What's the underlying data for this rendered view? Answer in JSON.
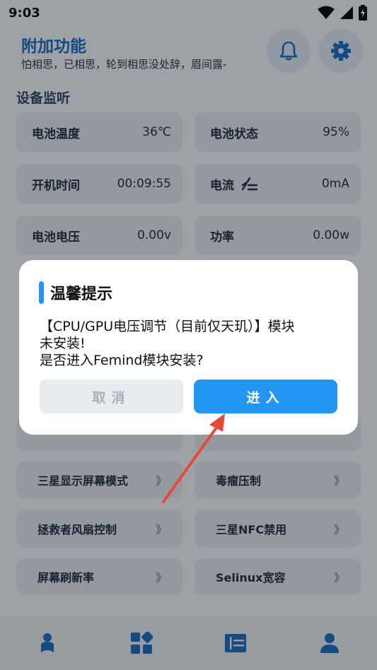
{
  "status_bar": {
    "time": "9:03"
  },
  "header": {
    "title": "附加功能",
    "subtitle": "怕相思，已相思，轮到相思没处辞，眉间露-"
  },
  "monitor": {
    "title": "设备监听",
    "cards": [
      {
        "label": "电池温度",
        "value": "36℃"
      },
      {
        "label": "电池状态",
        "value": "95%"
      },
      {
        "label": "开机时间",
        "value": "00:09:55"
      },
      {
        "label": "电流",
        "value": "0mA"
      },
      {
        "label": "电池电压",
        "value": "0.00v"
      },
      {
        "label": "功率",
        "value": "0.00w"
      }
    ]
  },
  "features": [
    {
      "label": "三星显示屏幕模式",
      "arrow": "》"
    },
    {
      "label": "毒瘤压制",
      "arrow": "》"
    },
    {
      "label": "拯救者风扇控制",
      "arrow": "》"
    },
    {
      "label": "三星NFC禁用",
      "arrow": "》"
    },
    {
      "label": "屏幕刷新率",
      "arrow": "》"
    },
    {
      "label": "Selinux宽容",
      "arrow": "》"
    }
  ],
  "dialog": {
    "title": "温馨提示",
    "message_lines": [
      "【CPU/GPU电压调节（目前仅天玑）】模块",
      "未安装!",
      "是否进入Femind模块安装?"
    ],
    "cancel_label": "取消",
    "enter_label": "进入"
  },
  "colors": {
    "accent": "#2196f3",
    "title_blue": "#1f6fbf",
    "background": "#e9eef4",
    "card": "#dbe2ea"
  },
  "icons": [
    "wifi-icon",
    "signal-icon",
    "battery-charging-icon",
    "bell-icon",
    "gear-icon",
    "current-icon",
    "home-icon",
    "apps-icon",
    "list-icon",
    "user-icon"
  ]
}
